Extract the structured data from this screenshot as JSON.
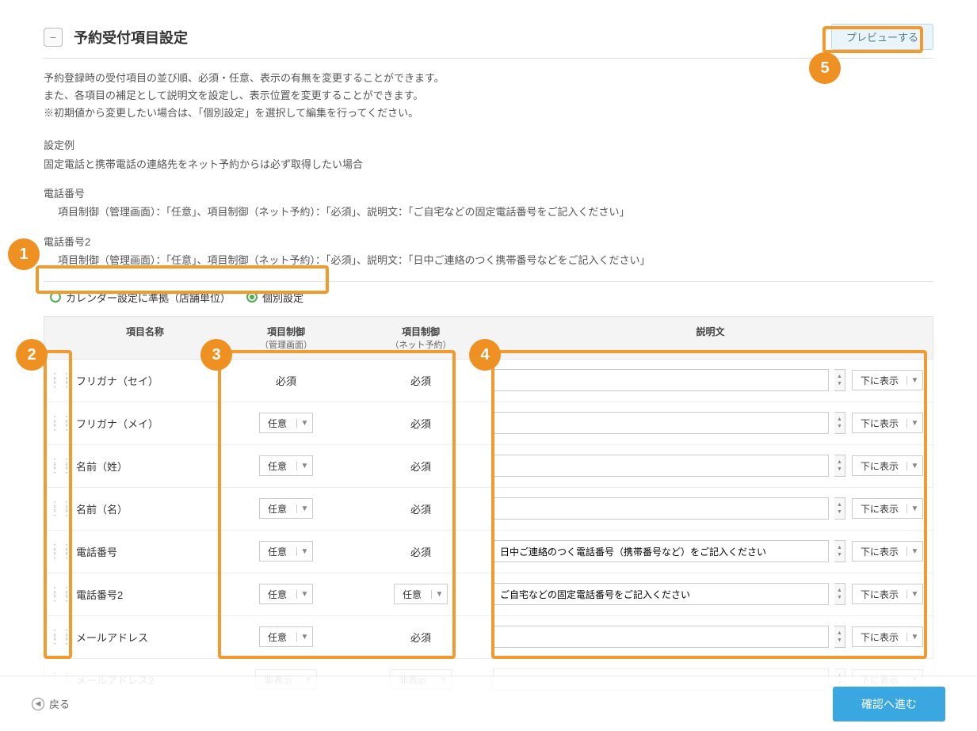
{
  "header": {
    "collapse_icon": "−",
    "title": "予約受付項目設定",
    "preview_button": "プレビューする"
  },
  "description": {
    "line1": "予約登録時の受付項目の並び順、必須・任意、表示の有無を変更することができます。",
    "line2": "また、各項目の補足として説明文を設定し、表示位置を変更することができます。",
    "line3": "※初期値から変更したい場合は、「個別設定」を選択して編集を行ってください。"
  },
  "example": {
    "title": "設定例",
    "subtitle": "固定電話と携帯電話の連絡先をネット予約からは必ず取得したい場合",
    "block1_title": "電話番号",
    "block1_body": "項目制御（管理画面）：「任意」、項目制御（ネット予約）：「必須」、説明文：「ご自宅などの固定電話番号をご記入ください」",
    "block2_title": "電話番号2",
    "block2_body": "項目制御（管理画面）：「任意」、項目制御（ネット予約）：「必須」、説明文：「日中ご連絡のつく携帯番号などをご記入ください」"
  },
  "toggle": {
    "option1": "カレンダー設定に準拠（店舗単位）",
    "option2": "個別設定"
  },
  "columns": {
    "name": "項目名称",
    "ctrl1_line1": "項目制御",
    "ctrl1_line2": "（管理画面）",
    "ctrl2_line1": "項目制御",
    "ctrl2_line2": "（ネット予約）",
    "desc": "説明文"
  },
  "position_default": "下に表示",
  "rows": [
    {
      "name": "フリガナ（セイ）",
      "ctrl1_type": "text",
      "ctrl1": "必須",
      "ctrl2_type": "text",
      "ctrl2": "必須",
      "desc": "",
      "pos": "下に表示"
    },
    {
      "name": "フリガナ（メイ）",
      "ctrl1_type": "select",
      "ctrl1": "任意",
      "ctrl2_type": "text",
      "ctrl2": "必須",
      "desc": "",
      "pos": "下に表示"
    },
    {
      "name": "名前（姓）",
      "ctrl1_type": "select",
      "ctrl1": "任意",
      "ctrl2_type": "text",
      "ctrl2": "必須",
      "desc": "",
      "pos": "下に表示"
    },
    {
      "name": "名前（名）",
      "ctrl1_type": "select",
      "ctrl1": "任意",
      "ctrl2_type": "text",
      "ctrl2": "必須",
      "desc": "",
      "pos": "下に表示"
    },
    {
      "name": "電話番号",
      "ctrl1_type": "select",
      "ctrl1": "任意",
      "ctrl2_type": "text",
      "ctrl2": "必須",
      "desc": "日中ご連絡のつく電話番号（携帯番号など）をご記入ください",
      "pos": "下に表示"
    },
    {
      "name": "電話番号2",
      "ctrl1_type": "select",
      "ctrl1": "任意",
      "ctrl2_type": "select",
      "ctrl2": "任意",
      "desc": "ご自宅などの固定電話番号をご記入ください",
      "pos": "下に表示"
    },
    {
      "name": "メールアドレス",
      "ctrl1_type": "select",
      "ctrl1": "任意",
      "ctrl2_type": "text",
      "ctrl2": "必須",
      "desc": "",
      "pos": "下に表示"
    },
    {
      "name": "メールアドレス2",
      "ctrl1_type": "select",
      "ctrl1": "非表示",
      "ctrl2_type": "select",
      "ctrl2": "非表示",
      "desc": "",
      "pos": "下に表示",
      "dimmed": true
    }
  ],
  "footer": {
    "back": "戻る",
    "confirm": "確認へ進む"
  },
  "callouts": {
    "c1": "1",
    "c2": "2",
    "c3": "3",
    "c4": "4",
    "c5": "5"
  }
}
